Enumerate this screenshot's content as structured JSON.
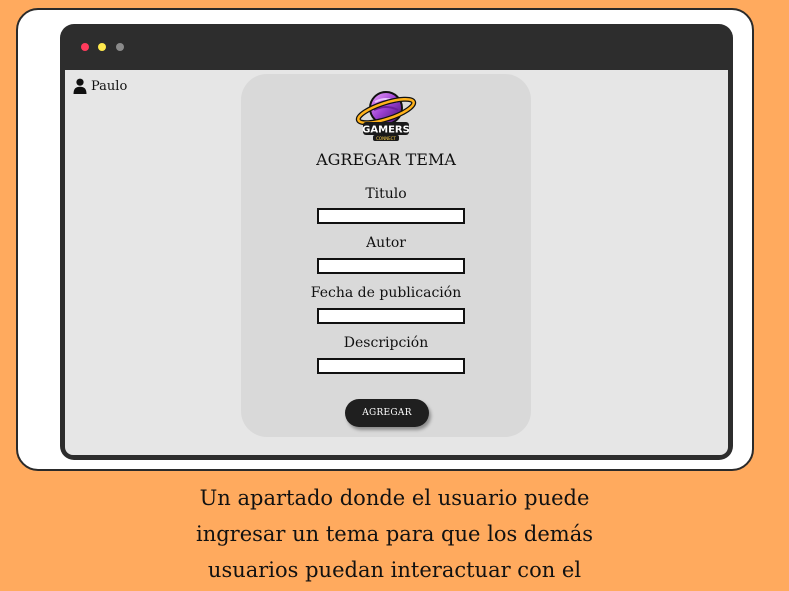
{
  "user": {
    "name": "Paulo"
  },
  "logo": {
    "text": "GAMERS",
    "subtext": "CONNECT"
  },
  "form": {
    "title": "AGREGAR TEMA",
    "fields": [
      {
        "label": "Titulo",
        "value": ""
      },
      {
        "label": "Autor",
        "value": ""
      },
      {
        "label": "Fecha de publicación",
        "value": ""
      },
      {
        "label": "Descripción",
        "value": ""
      }
    ],
    "submit_label": "AGREGAR"
  },
  "caption": {
    "lines": [
      "Un apartado donde el usuario puede",
      "ingresar un tema para que los demás",
      "usuarios puedan interactuar con el"
    ]
  },
  "colors": {
    "background": "#ffaa5e",
    "window_bar": "#2d2d2d",
    "content_bg": "#e6e6e6",
    "panel_bg": "#d9d9d9",
    "button_bg": "#1f1f1f"
  }
}
